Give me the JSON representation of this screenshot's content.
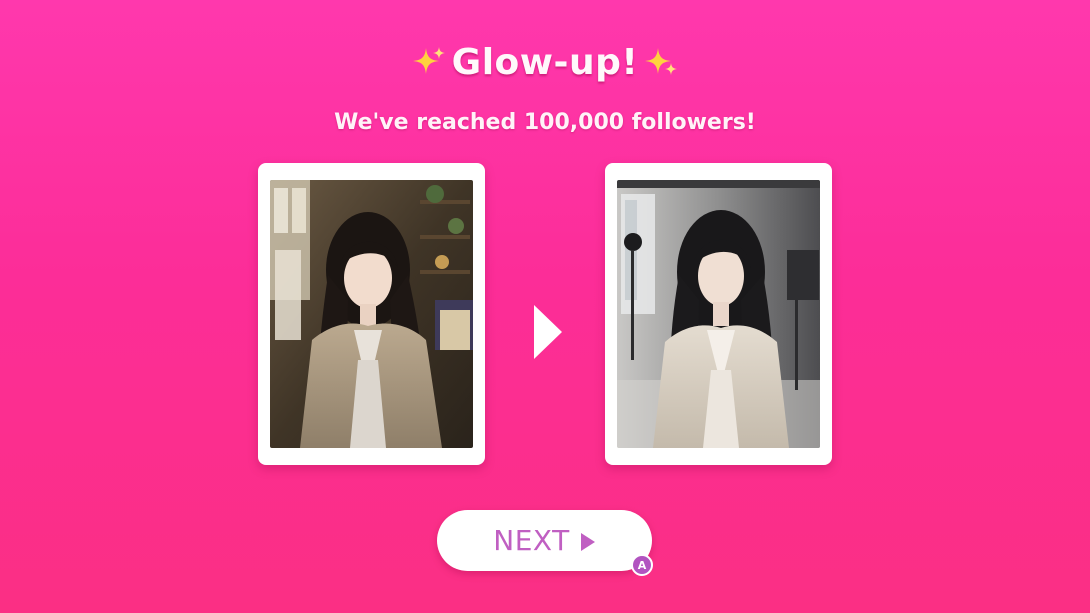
{
  "header": {
    "title": "Glow-up!",
    "subtitle": "We've reached 100,000 followers!",
    "sparkle_color": "#ffd23f"
  },
  "comparison": {
    "before_image": "portrait-before-cozy-room",
    "after_image": "portrait-after-studio",
    "arrow_icon": "arrow-right-icon"
  },
  "controls": {
    "next_label": "NEXT",
    "next_icon": "play-icon",
    "button_hint": "A"
  },
  "colors": {
    "background_top": "#ff38ad",
    "background_bottom": "#fb2f84",
    "next_text": "#c05fc2",
    "badge": "#b254c0"
  }
}
